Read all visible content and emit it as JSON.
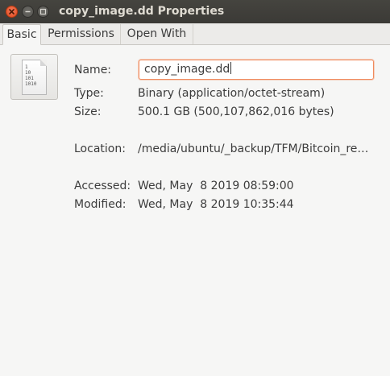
{
  "window": {
    "title": "copy_image.dd Properties"
  },
  "tabs": [
    {
      "label": "Basic",
      "active": true
    },
    {
      "label": "Permissions",
      "active": false
    },
    {
      "label": "Open With",
      "active": false
    }
  ],
  "file_icon": {
    "icon": "binary-file-icon",
    "glyph_text": "1\n10\n101\n1010"
  },
  "fields": {
    "name": {
      "label": "Name:",
      "value": "copy_image.dd"
    },
    "type": {
      "label": "Type:",
      "value": "Binary (application/octet-stream)"
    },
    "size": {
      "label": "Size:",
      "value": "500.1 GB (500,107,862,016 bytes)"
    },
    "location": {
      "label": "Location:",
      "value": "/media/ubuntu/_backup/TFM/Bitcoin_re…"
    },
    "accessed": {
      "label": "Accessed:",
      "value": "Wed, May  8 2019 08:59:00"
    },
    "modified": {
      "label": "Modified:",
      "value": "Wed, May  8 2019 10:35:44"
    }
  },
  "colors": {
    "titlebar": "#3c3b37",
    "close_button": "#e8572b",
    "input_focus_border": "#f08a5d",
    "background": "#f6f6f5"
  }
}
